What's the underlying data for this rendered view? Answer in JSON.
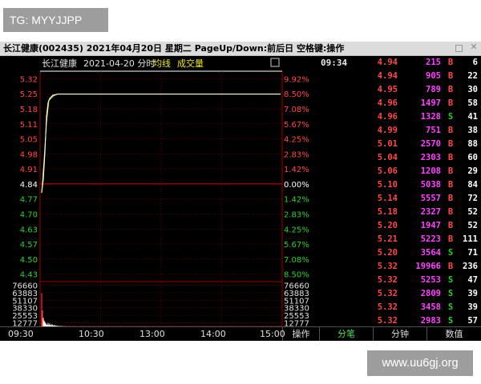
{
  "watermarks": {
    "top": "TG: MYYJJPP",
    "bottom": "www.uu6gj.org"
  },
  "window": {
    "title": "长江健康(002435)  2021年04月20日  星期二  PageUp/Down:前后日  空格键:操作",
    "icons": [
      "restore-icon",
      "close-icon"
    ]
  },
  "chart_header": {
    "name": "长江健康",
    "date_label": "2021-04-20 分时",
    "avg_label": "均线",
    "vol_label": "成交量"
  },
  "colors": {
    "up": "#ff4848",
    "down": "#33cc33",
    "neutral": "#ffffff",
    "price_line": "#ffffff",
    "avg_line": "#e8e830",
    "grid": "#8b0000",
    "volume": "#ff44ff"
  },
  "chart_data": {
    "type": "line",
    "title": "长江健康 2021-04-20 分时",
    "prev_close": 4.84,
    "price_axis_left": [
      "5.32",
      "5.25",
      "5.18",
      "5.11",
      "5.05",
      "4.98",
      "4.91",
      "4.84",
      "4.77",
      "4.70",
      "4.63",
      "4.57",
      "4.50",
      "4.43"
    ],
    "price_axis_right": [
      "9.92%",
      "8.50%",
      "7.08%",
      "5.67%",
      "4.25%",
      "2.83%",
      "1.42%",
      "0.00%",
      "1.42%",
      "2.83%",
      "4.25%",
      "5.67%",
      "7.08%",
      "8.50%"
    ],
    "ylim": [
      4.43,
      5.32
    ],
    "x_ticks": [
      "09:30",
      "10:30",
      "13:00",
      "14:00",
      "15:00"
    ],
    "price_series": [
      [
        0,
        4.8
      ],
      [
        2,
        4.86
      ],
      [
        4,
        4.98
      ],
      [
        6,
        5.15
      ],
      [
        8,
        5.21
      ],
      [
        10,
        5.23
      ],
      [
        14,
        5.245
      ],
      [
        20,
        5.25
      ],
      [
        40,
        5.25
      ],
      [
        240,
        5.25
      ],
      [
        300,
        5.25
      ]
    ],
    "avg_series": [
      [
        0,
        4.8
      ],
      [
        3,
        4.95
      ],
      [
        6,
        5.12
      ],
      [
        9,
        5.22
      ],
      [
        14,
        5.24
      ],
      [
        20,
        5.25
      ],
      [
        300,
        5.25
      ]
    ],
    "volume_axis": [
      "76660",
      "63883",
      "51107",
      "38330",
      "25553",
      "12777"
    ],
    "volume_max": 76660,
    "volumes": [
      [
        0,
        62000
      ],
      [
        1,
        30000
      ],
      [
        2,
        16000
      ],
      [
        3,
        11000
      ],
      [
        4,
        8500
      ],
      [
        5,
        6000
      ],
      [
        6,
        4200
      ],
      [
        7,
        3000
      ],
      [
        8,
        6500
      ],
      [
        9,
        2500
      ],
      [
        10,
        5500
      ],
      [
        11,
        3000
      ],
      [
        12,
        2000
      ],
      [
        13,
        4200
      ],
      [
        14,
        2400
      ],
      [
        15,
        1500
      ],
      [
        16,
        2800
      ],
      [
        17,
        1200
      ],
      [
        18,
        1600
      ],
      [
        19,
        900
      ],
      [
        20,
        1200
      ],
      [
        21,
        700
      ],
      [
        22,
        800
      ],
      [
        23,
        500
      ],
      [
        24,
        700
      ],
      [
        25,
        400
      ],
      [
        26,
        500
      ],
      [
        28,
        300
      ],
      [
        30,
        400
      ],
      [
        35,
        300
      ],
      [
        40,
        250
      ],
      [
        50,
        200
      ],
      [
        60,
        200
      ],
      [
        80,
        150
      ],
      [
        100,
        150
      ],
      [
        130,
        120
      ],
      [
        160,
        100
      ],
      [
        200,
        100
      ],
      [
        239,
        150
      ]
    ]
  },
  "ticks": {
    "time": "09:34",
    "rows": [
      {
        "price": "4.94",
        "vol": "215",
        "dir": "B",
        "count": "6"
      },
      {
        "price": "4.94",
        "vol": "905",
        "dir": "B",
        "count": "22"
      },
      {
        "price": "4.95",
        "vol": "789",
        "dir": "B",
        "count": "30"
      },
      {
        "price": "4.96",
        "vol": "1497",
        "dir": "B",
        "count": "58"
      },
      {
        "price": "4.96",
        "vol": "1328",
        "dir": "S",
        "count": "41"
      },
      {
        "price": "4.99",
        "vol": "751",
        "dir": "B",
        "count": "38"
      },
      {
        "price": "5.01",
        "vol": "2570",
        "dir": "B",
        "count": "88"
      },
      {
        "price": "5.04",
        "vol": "2303",
        "dir": "B",
        "count": "60"
      },
      {
        "price": "5.06",
        "vol": "1208",
        "dir": "B",
        "count": "29"
      },
      {
        "price": "5.10",
        "vol": "5038",
        "dir": "B",
        "count": "84"
      },
      {
        "price": "5.14",
        "vol": "5557",
        "dir": "B",
        "count": "72"
      },
      {
        "price": "5.18",
        "vol": "2327",
        "dir": "B",
        "count": "52"
      },
      {
        "price": "5.20",
        "vol": "1947",
        "dir": "B",
        "count": "52"
      },
      {
        "price": "5.21",
        "vol": "5223",
        "dir": "B",
        "count": "111"
      },
      {
        "price": "5.20",
        "vol": "3564",
        "dir": "S",
        "count": "71"
      },
      {
        "price": "5.32",
        "vol": "19966",
        "dir": "B",
        "count": "236"
      },
      {
        "price": "5.32",
        "vol": "5253",
        "dir": "S",
        "count": "47"
      },
      {
        "price": "5.32",
        "vol": "2809",
        "dir": "S",
        "count": "39"
      },
      {
        "price": "5.32",
        "vol": "3458",
        "dir": "S",
        "count": "39"
      },
      {
        "price": "5.32",
        "vol": "2983",
        "dir": "S",
        "count": "57"
      }
    ]
  },
  "tabs": {
    "operate": "操作",
    "fenbi": "分笔",
    "fenzhong": "分钟",
    "shuzhi": "数值"
  }
}
